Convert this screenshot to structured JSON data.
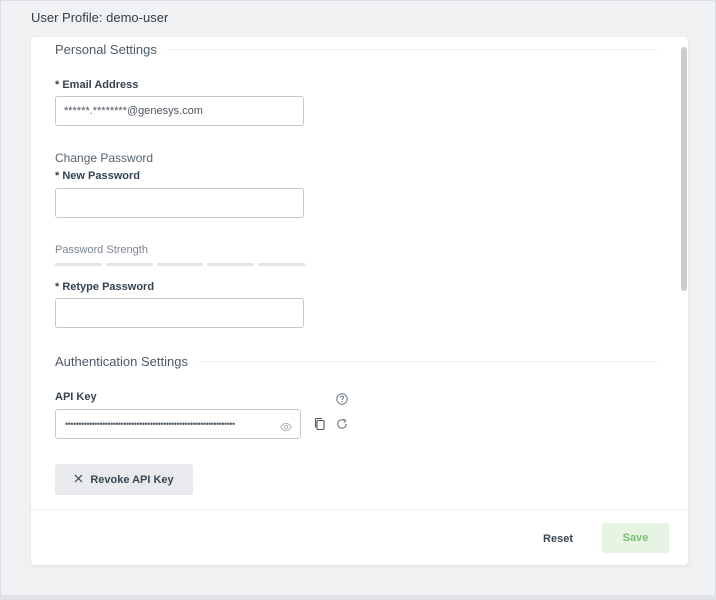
{
  "page": {
    "title": "User Profile: demo-user"
  },
  "personal": {
    "heading": "Personal Settings",
    "email_label": "* Email Address",
    "email_value": "******.********@genesys.com",
    "change_password_heading": "Change Password",
    "new_password_label": "* New Password",
    "new_password_value": "",
    "strength_label": "Password Strength",
    "strength_level": 0,
    "strength_segments": 5,
    "retype_password_label": "* Retype Password",
    "retype_password_value": ""
  },
  "auth": {
    "heading": "Authentication Settings",
    "api_key_label": "API Key",
    "api_key_masked": "••••••••••••••••••••••••••••••••••••••••••••••••••••••••••••••••",
    "revoke_label": "Revoke API Key"
  },
  "footer": {
    "reset_label": "Reset",
    "save_label": "Save"
  },
  "icons": {
    "help": "help-circle-icon",
    "eye": "eye-icon",
    "copy": "copy-icon",
    "refresh": "refresh-icon",
    "close": "close-icon"
  },
  "colors": {
    "save_bg": "#e6f4e2",
    "save_text": "#7cbf72",
    "text": "#2f3d4a"
  }
}
